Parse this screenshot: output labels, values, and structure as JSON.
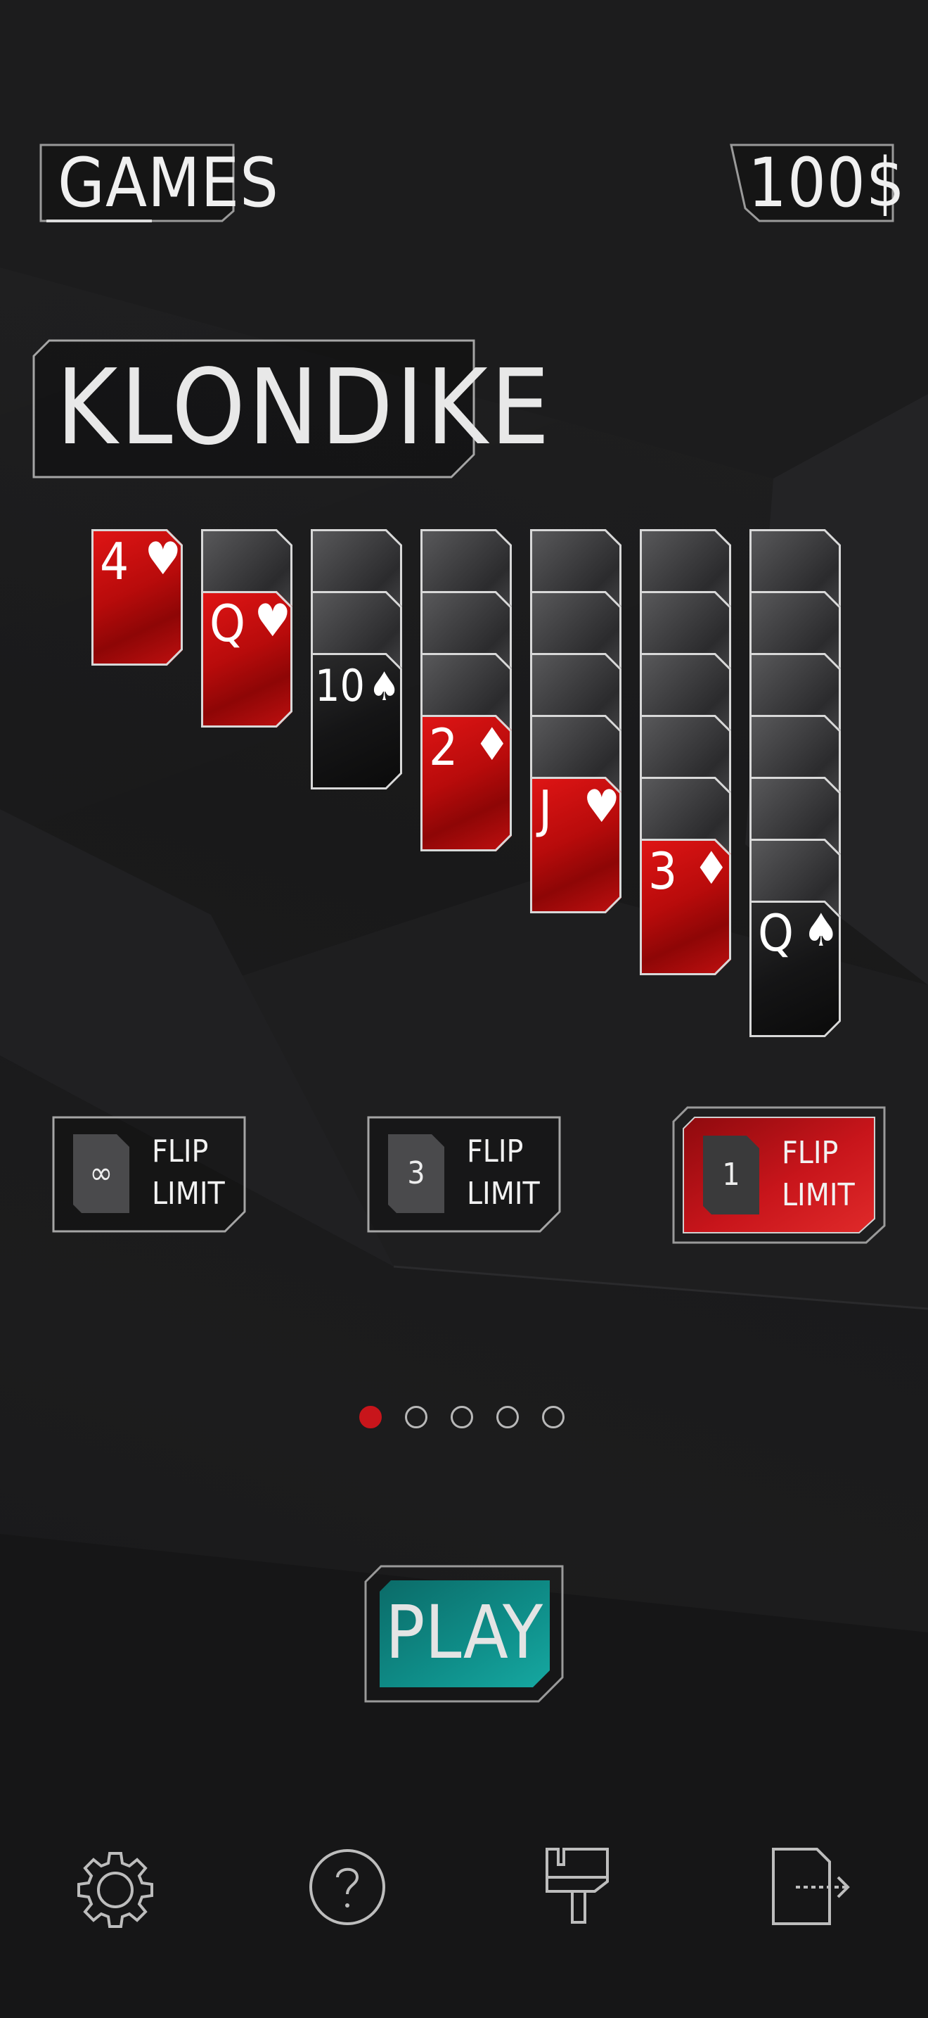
{
  "header": {
    "games_label": "GAMES",
    "balance": "100$"
  },
  "game": {
    "title": "KLONDIKE",
    "tableau": [
      {
        "hidden": 0,
        "face": {
          "rank": "4",
          "suit": "♥",
          "color": "red"
        }
      },
      {
        "hidden": 1,
        "face": {
          "rank": "Q",
          "suit": "♥",
          "color": "red"
        }
      },
      {
        "hidden": 2,
        "face": {
          "rank": "10",
          "suit": "♠",
          "color": "black"
        }
      },
      {
        "hidden": 3,
        "face": {
          "rank": "2",
          "suit": "♦",
          "color": "red"
        }
      },
      {
        "hidden": 4,
        "face": {
          "rank": "J",
          "suit": "♥",
          "color": "red"
        }
      },
      {
        "hidden": 5,
        "face": {
          "rank": "3",
          "suit": "♦",
          "color": "red"
        }
      },
      {
        "hidden": 6,
        "face": {
          "rank": "Q",
          "suit": "♠",
          "color": "black"
        }
      }
    ]
  },
  "flip_options": [
    {
      "badge": "∞",
      "line1": "FLIP",
      "line2": "LIMIT",
      "selected": false
    },
    {
      "badge": "3",
      "line1": "FLIP",
      "line2": "LIMIT",
      "selected": false
    },
    {
      "badge": "1",
      "line1": "FLIP",
      "line2": "LIMIT",
      "selected": true
    }
  ],
  "pager": {
    "count": 5,
    "active": 0
  },
  "play_label": "PLAY",
  "bottom_bar": [
    "gear-icon",
    "help-icon",
    "paint-brush-icon",
    "exit-icon"
  ],
  "colors": {
    "accent_red": "#c8151b",
    "play_teal": "#0e8f8a",
    "background": "#1a1a1b"
  }
}
